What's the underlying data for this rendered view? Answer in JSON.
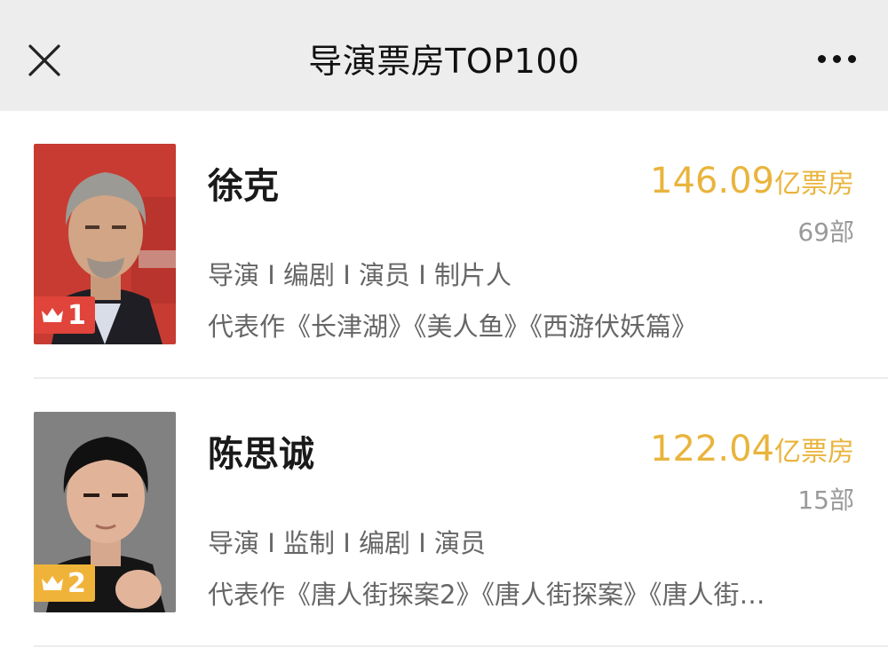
{
  "header": {
    "title": "导演票房TOP100"
  },
  "directors": [
    {
      "rank": "1",
      "name": "徐克",
      "box_office": "146.09",
      "box_office_unit": "亿票房",
      "film_count": "69部",
      "roles": "导演 I 编剧 I 演员 I 制片人",
      "works": "代表作《长津湖》《美人鱼》《西游伏妖篇》",
      "badge_color": "#e0443a"
    },
    {
      "rank": "2",
      "name": "陈思诚",
      "box_office": "122.04",
      "box_office_unit": "亿票房",
      "film_count": "15部",
      "roles": "导演 I 监制 I 编剧 I 演员",
      "works": "代表作《唐人街探案2》《唐人街探案》《唐人街…",
      "badge_color": "#f0b33a"
    }
  ],
  "colors": {
    "accent": "#e9b43c",
    "topbar": "#ededed",
    "muted": "#9a9a9a"
  }
}
